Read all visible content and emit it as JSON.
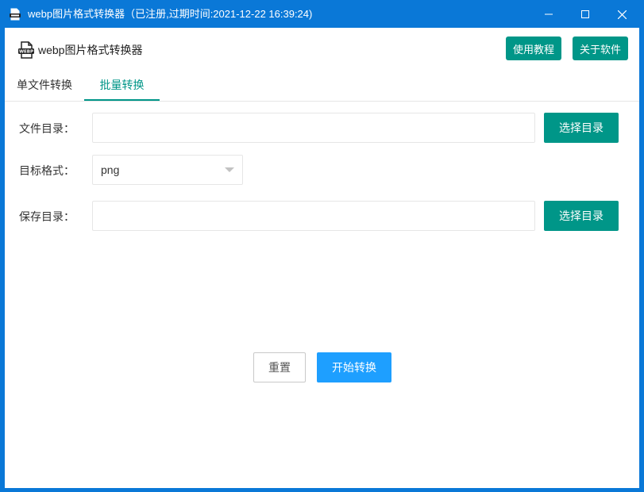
{
  "window": {
    "title": "webp图片格式转换器（已注册,过期时间:2021-12-22 16:39:24)",
    "icons": {
      "app": "webp-file-icon",
      "minimize": "minimize-icon",
      "maximize": "maximize-icon",
      "close": "close-icon"
    }
  },
  "header": {
    "app_name": "webp图片格式转换器",
    "tutorial_label": "使用教程",
    "about_label": "关于软件"
  },
  "tabs": [
    {
      "label": "单文件转换",
      "active": false
    },
    {
      "label": "批量转换",
      "active": true
    }
  ],
  "form": {
    "file_dir": {
      "label": "文件目录：",
      "value": "",
      "button": "选择目录"
    },
    "target_format": {
      "label": "目标格式：",
      "selected": "png"
    },
    "save_dir": {
      "label": "保存目录：",
      "value": "",
      "button": "选择目录"
    }
  },
  "actions": {
    "reset_label": "重置",
    "start_label": "开始转换"
  },
  "colors": {
    "titlebar": "#0a78d7",
    "accent_green": "#009688",
    "primary_blue": "#1e9fff"
  }
}
